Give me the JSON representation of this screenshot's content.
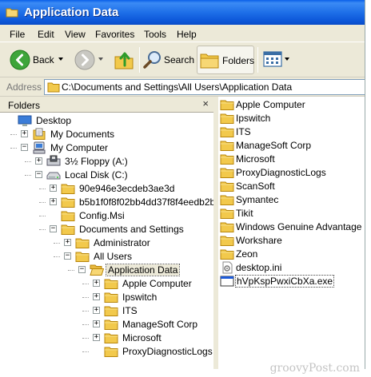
{
  "window": {
    "title": "Application Data"
  },
  "menu": [
    "File",
    "Edit",
    "View",
    "Favorites",
    "Tools",
    "Help"
  ],
  "toolbar": {
    "back_label": "Back",
    "search_label": "Search",
    "folders_label": "Folders"
  },
  "address": {
    "label": "Address",
    "path": "C:\\Documents and Settings\\All Users\\Application Data"
  },
  "folders_pane": {
    "header": "Folders",
    "close_glyph": "×",
    "tree": [
      {
        "label": "Desktop",
        "icon": "desktop-icon",
        "expander": ""
      },
      {
        "label": "My Documents",
        "icon": "my-documents-icon",
        "expander": "+"
      },
      {
        "label": "My Computer",
        "icon": "my-computer-icon",
        "expander": "−"
      },
      {
        "label": "3½ Floppy (A:)",
        "icon": "floppy-drive-icon",
        "expander": "+"
      },
      {
        "label": "Local Disk (C:)",
        "icon": "hard-disk-icon",
        "expander": "−"
      },
      {
        "label": "90e946e3ecdeb3ae3d",
        "icon": "folder-icon",
        "expander": "+"
      },
      {
        "label": "b5b1f0f8f02bb4dd37f8f4eedb2b",
        "icon": "folder-icon",
        "expander": "+"
      },
      {
        "label": "Config.Msi",
        "icon": "folder-icon",
        "expander": ""
      },
      {
        "label": "Documents and Settings",
        "icon": "folder-icon",
        "expander": "−"
      },
      {
        "label": "Administrator",
        "icon": "folder-icon",
        "expander": "+"
      },
      {
        "label": "All Users",
        "icon": "folder-icon",
        "expander": "−"
      },
      {
        "label": "Application Data",
        "icon": "open-folder-icon",
        "expander": "−"
      },
      {
        "label": "Apple Computer",
        "icon": "folder-icon",
        "expander": "+"
      },
      {
        "label": "Ipswitch",
        "icon": "folder-icon",
        "expander": "+"
      },
      {
        "label": "ITS",
        "icon": "folder-icon",
        "expander": "+"
      },
      {
        "label": "ManageSoft Corp",
        "icon": "folder-icon",
        "expander": "+"
      },
      {
        "label": "Microsoft",
        "icon": "folder-icon",
        "expander": "+"
      },
      {
        "label": "ProxyDiagnosticLogs",
        "icon": "folder-icon",
        "expander": ""
      }
    ]
  },
  "content": {
    "items": [
      {
        "label": "Apple Computer",
        "icon": "folder-icon"
      },
      {
        "label": "Ipswitch",
        "icon": "folder-icon"
      },
      {
        "label": "ITS",
        "icon": "folder-icon"
      },
      {
        "label": "ManageSoft Corp",
        "icon": "folder-icon"
      },
      {
        "label": "Microsoft",
        "icon": "folder-icon"
      },
      {
        "label": "ProxyDiagnosticLogs",
        "icon": "folder-icon"
      },
      {
        "label": "ScanSoft",
        "icon": "folder-icon"
      },
      {
        "label": "Symantec",
        "icon": "folder-icon"
      },
      {
        "label": "Tikit",
        "icon": "folder-icon"
      },
      {
        "label": "Windows Genuine Advantage",
        "icon": "folder-icon"
      },
      {
        "label": "Workshare",
        "icon": "folder-icon"
      },
      {
        "label": "Zeon",
        "icon": "folder-icon"
      },
      {
        "label": "desktop.ini",
        "icon": "settings-file-icon"
      },
      {
        "label": "hVpKspPwxiCbXa.exe",
        "icon": "exe-file-icon"
      }
    ]
  },
  "watermark": "groovyPost.com",
  "colors": {
    "titlebar": "#0A5FE8",
    "chrome": "#ECE9D8",
    "folder": "#F2C94C"
  }
}
